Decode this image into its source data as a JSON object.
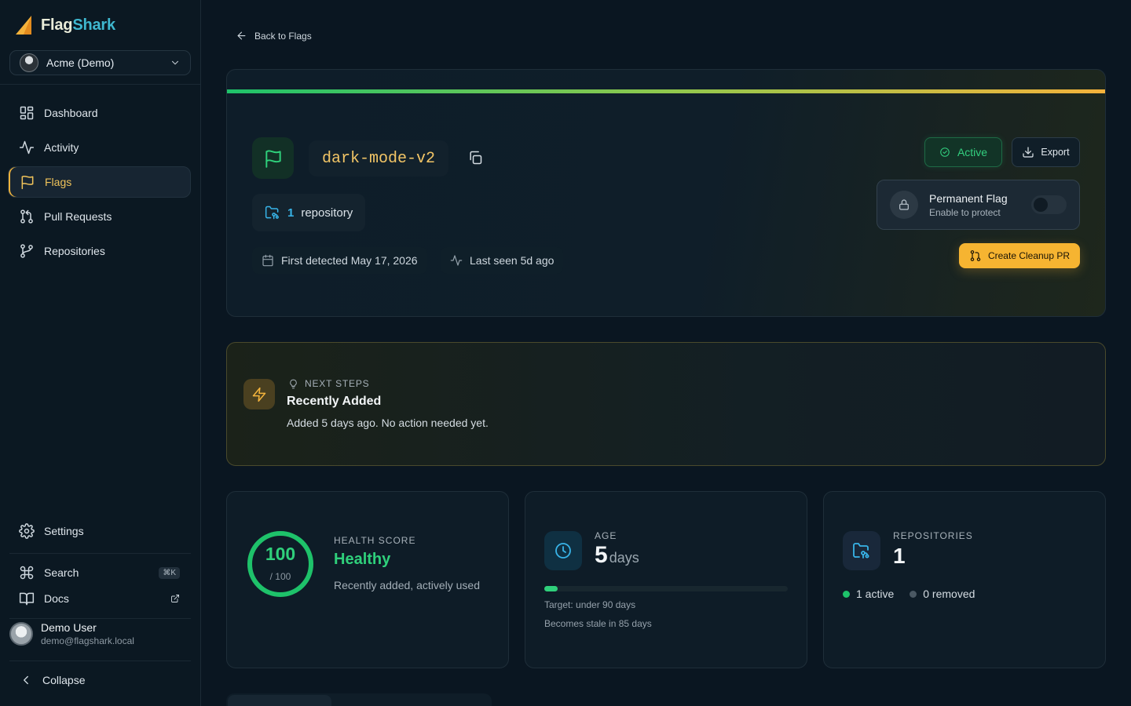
{
  "app": {
    "logo_part1": "Flag",
    "logo_part2": "Shark",
    "org_name": "Acme (Demo)"
  },
  "nav": [
    {
      "label": "Dashboard"
    },
    {
      "label": "Activity"
    },
    {
      "label": "Flags"
    },
    {
      "label": "Pull Requests"
    },
    {
      "label": "Repositories"
    }
  ],
  "sidebar_bottom": {
    "settings": "Settings",
    "search": "Search",
    "search_shortcut": "⌘K",
    "docs": "Docs",
    "collapse": "Collapse"
  },
  "user": {
    "name": "Demo User",
    "email": "demo@flagshark.local"
  },
  "back_link": "Back to Flags",
  "flag": {
    "name": "dark-mode-v2",
    "repo_count": "1",
    "repo_word": "repository",
    "first_detected": "First detected May 17, 2026",
    "last_seen": "Last seen 5d ago",
    "status": "Active",
    "export_label": "Export",
    "permanent_title": "Permanent Flag",
    "permanent_sub": "Enable to protect",
    "permanent_enabled": false,
    "cleanup_label": "Create Cleanup PR"
  },
  "next_steps": {
    "label": "NEXT STEPS",
    "title": "Recently Added",
    "description": "Added 5 days ago. No action needed yet."
  },
  "health": {
    "label": "HEALTH SCORE",
    "score": "100",
    "max": "/ 100",
    "score_fraction": 1.0,
    "status": "Healthy",
    "description": "Recently added, actively used"
  },
  "age": {
    "label": "AGE",
    "value": "5",
    "unit": "days",
    "progress_fraction": 0.056,
    "target": "Target: under 90 days",
    "stale": "Becomes stale in 85 days"
  },
  "repositories": {
    "label": "REPOSITORIES",
    "value": "1",
    "active": "1 active",
    "removed": "0 removed"
  },
  "colors": {
    "accent_green": "#2fd07b",
    "accent_amber": "#f6b431",
    "accent_blue": "#38b4e8",
    "background": "#0a1621"
  }
}
